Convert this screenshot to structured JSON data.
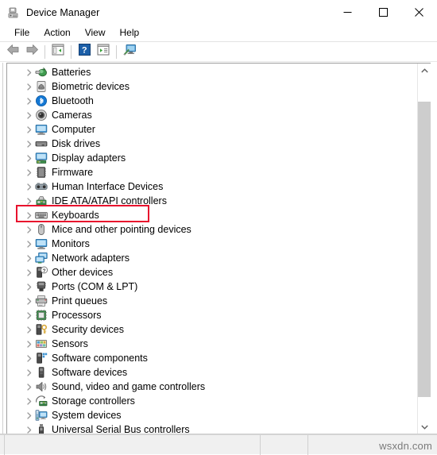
{
  "window": {
    "title": "Device Manager",
    "icon": "device-manager-icon",
    "controls": [
      {
        "name": "minimize-button",
        "glyph": "—"
      },
      {
        "name": "maximize-button",
        "glyph": "□"
      },
      {
        "name": "close-button",
        "glyph": "✕"
      }
    ]
  },
  "menubar": {
    "items": [
      {
        "label": "File"
      },
      {
        "label": "Action"
      },
      {
        "label": "View"
      },
      {
        "label": "Help"
      }
    ]
  },
  "toolbar": {
    "buttons": [
      {
        "name": "back-button",
        "icon": "left-arrow-icon"
      },
      {
        "name": "forward-button",
        "icon": "right-arrow-icon"
      },
      {
        "name": "show-hide-console-tree-button",
        "icon": "console-tree-icon"
      },
      {
        "name": "help-button",
        "icon": "help-question-icon"
      },
      {
        "name": "properties-button",
        "icon": "properties-window-icon"
      },
      {
        "name": "scan-for-hardware-changes-button",
        "icon": "scan-hardware-icon"
      }
    ]
  },
  "tree": {
    "items": [
      {
        "label": "Batteries",
        "icon": "battery-icon",
        "expandable": true,
        "highlighted": false
      },
      {
        "label": "Biometric devices",
        "icon": "fingerprint-icon",
        "expandable": true,
        "highlighted": false
      },
      {
        "label": "Bluetooth",
        "icon": "bluetooth-icon",
        "expandable": true,
        "highlighted": false
      },
      {
        "label": "Cameras",
        "icon": "camera-icon",
        "expandable": true,
        "highlighted": false
      },
      {
        "label": "Computer",
        "icon": "computer-icon",
        "expandable": true,
        "highlighted": false
      },
      {
        "label": "Disk drives",
        "icon": "disk-drive-icon",
        "expandable": true,
        "highlighted": false
      },
      {
        "label": "Display adapters",
        "icon": "display-adapter-icon",
        "expandable": true,
        "highlighted": false
      },
      {
        "label": "Firmware",
        "icon": "firmware-icon",
        "expandable": true,
        "highlighted": false
      },
      {
        "label": "Human Interface Devices",
        "icon": "hid-icon",
        "expandable": true,
        "highlighted": false
      },
      {
        "label": "IDE ATA/ATAPI controllers",
        "icon": "ide-controller-icon",
        "expandable": true,
        "highlighted": false
      },
      {
        "label": "Keyboards",
        "icon": "keyboard-icon",
        "expandable": true,
        "highlighted": true
      },
      {
        "label": "Mice and other pointing devices",
        "icon": "mouse-icon",
        "expandable": true,
        "highlighted": false
      },
      {
        "label": "Monitors",
        "icon": "monitor-icon",
        "expandable": true,
        "highlighted": false
      },
      {
        "label": "Network adapters",
        "icon": "network-adapter-icon",
        "expandable": true,
        "highlighted": false
      },
      {
        "label": "Other devices",
        "icon": "other-device-icon",
        "expandable": true,
        "highlighted": false
      },
      {
        "label": "Ports (COM & LPT)",
        "icon": "port-icon",
        "expandable": true,
        "highlighted": false
      },
      {
        "label": "Print queues",
        "icon": "printer-icon",
        "expandable": true,
        "highlighted": false
      },
      {
        "label": "Processors",
        "icon": "processor-icon",
        "expandable": true,
        "highlighted": false
      },
      {
        "label": "Security devices",
        "icon": "security-device-icon",
        "expandable": true,
        "highlighted": false
      },
      {
        "label": "Sensors",
        "icon": "sensor-icon",
        "expandable": true,
        "highlighted": false
      },
      {
        "label": "Software components",
        "icon": "software-component-icon",
        "expandable": true,
        "highlighted": false
      },
      {
        "label": "Software devices",
        "icon": "software-device-icon",
        "expandable": true,
        "highlighted": false
      },
      {
        "label": "Sound, video and game controllers",
        "icon": "sound-icon",
        "expandable": true,
        "highlighted": false
      },
      {
        "label": "Storage controllers",
        "icon": "storage-controller-icon",
        "expandable": true,
        "highlighted": false
      },
      {
        "label": "System devices",
        "icon": "system-device-icon",
        "expandable": true,
        "highlighted": false
      },
      {
        "label": "Universal Serial Bus controllers",
        "icon": "usb-controller-icon",
        "expandable": true,
        "highlighted": false
      }
    ]
  },
  "scrollbar": {
    "up_arrow": "∧",
    "down_arrow": "∨"
  },
  "statusbar": {
    "segments": [
      "",
      "",
      ""
    ]
  },
  "watermark": {
    "text": "wsxdn.com"
  },
  "colors": {
    "highlight_box": "#e8112d",
    "scrollbar_thumb": "#cdcdcd",
    "statusbar_bg": "#f0f0f0"
  }
}
